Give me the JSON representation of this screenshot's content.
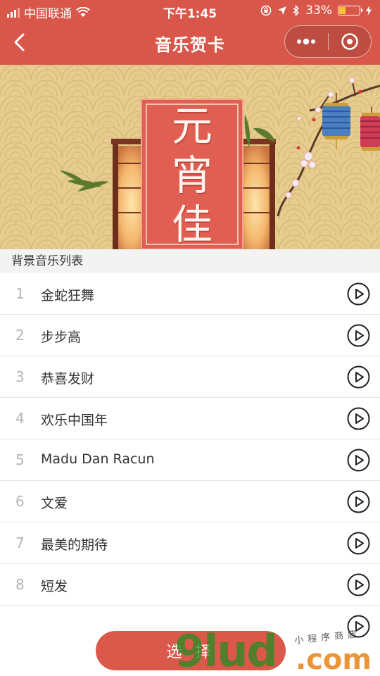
{
  "status_bar": {
    "carrier": "中国联通",
    "time": "下午1:45",
    "battery": "33%",
    "battery_level": 0.33
  },
  "nav": {
    "title": "音乐贺卡"
  },
  "banner": {
    "title": "元宵佳節"
  },
  "section_header": "背景音乐列表",
  "songs": [
    {
      "index": "1",
      "name": "金蛇狂舞"
    },
    {
      "index": "2",
      "name": "步步高"
    },
    {
      "index": "3",
      "name": "恭喜发财"
    },
    {
      "index": "4",
      "name": "欢乐中国年"
    },
    {
      "index": "5",
      "name": "Madu Dan Racun"
    },
    {
      "index": "6",
      "name": "文爱"
    },
    {
      "index": "7",
      "name": "最美的期待"
    },
    {
      "index": "8",
      "name": "短发"
    }
  ],
  "select_button": "选 择",
  "watermark": {
    "brand": "9lud",
    "domain": ".com",
    "tagline": "小程序商店"
  },
  "colors": {
    "accent": "#d9574a",
    "banner_bg": "#e6cc8e",
    "battery_fill": "#f7c532"
  }
}
